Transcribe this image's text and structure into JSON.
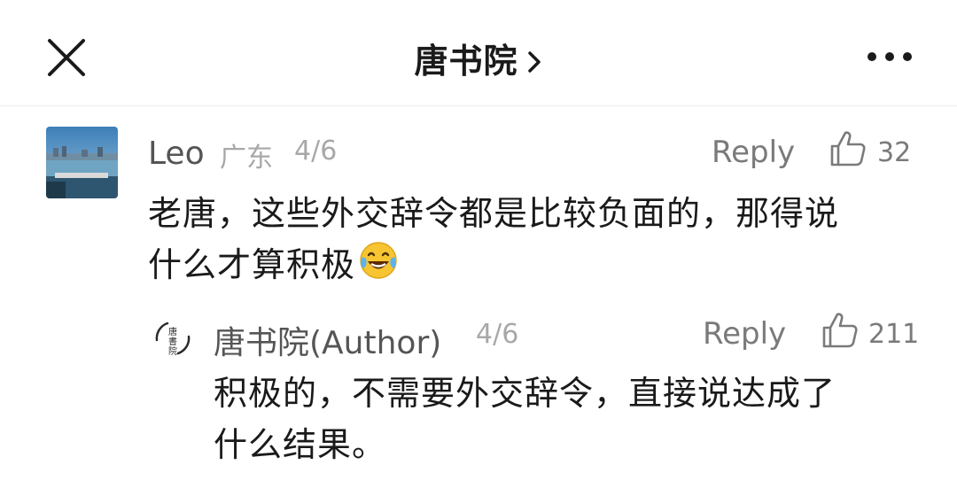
{
  "header": {
    "title": "唐书院",
    "close_icon": "close-icon",
    "chevron_icon": "chevron-right-icon",
    "more_icon": "more-dots-icon"
  },
  "comments": [
    {
      "name": "Leo",
      "location": "广东",
      "date": "4/6",
      "reply_label": "Reply",
      "likes": "32",
      "body_line1": "老唐，这些外交辞令都是比较负面的，那得说",
      "body_line2": "什么才算积极",
      "emoji": "laughing-tears-emoji",
      "avatar": "harbor-photo-avatar"
    },
    {
      "name": "唐书院(Author)",
      "date": "4/6",
      "reply_label": "Reply",
      "likes": "211",
      "body_line1": "积极的，不需要外交辞令，直接说达成了",
      "body_line2": "什么结果。",
      "avatar": "calligraphy-seal-avatar"
    }
  ],
  "colors": {
    "text": "#1a1a1a",
    "meta": "#7a7a7a",
    "muted": "#a8a8a8",
    "divider": "#ececec"
  }
}
